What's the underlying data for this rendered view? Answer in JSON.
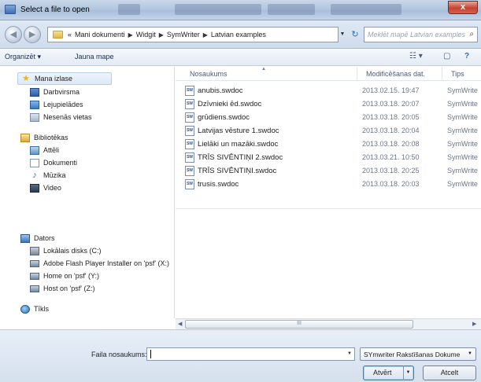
{
  "window": {
    "title": "Select a file to open",
    "close_label": "x"
  },
  "address": {
    "overflow": "«",
    "crumbs": [
      "Mani dokumenti",
      "Widgit",
      "SymWriter",
      "Latvian examples"
    ],
    "search_placeholder": "Meklēt mapē Latvian examples"
  },
  "toolbar": {
    "organize_label": "Organizēt ▾",
    "new_folder_label": "Jauna mape"
  },
  "nav": {
    "favorites": {
      "label": "Mana izlase",
      "items": [
        "Darbvirsma",
        "Lejupielādes",
        "Nesenās vietas"
      ]
    },
    "libraries": {
      "label": "Bibliotēkas",
      "items": [
        "Attēli",
        "Dokumenti",
        "Mūzika",
        "Video"
      ]
    },
    "computer": {
      "label": "Dators",
      "items": [
        "Lokālais disks (C:)",
        "Adobe Flash Player Installer on 'psf' (X:)",
        "Home on 'psf' (Y:)",
        "Host on 'psf' (Z:)"
      ]
    },
    "network": {
      "label": "Tīkls"
    }
  },
  "columns": {
    "name": "Nosaukums",
    "date": "Modificēšanas dat.",
    "type": "Tips"
  },
  "files": [
    {
      "icon": "SW",
      "name": "anubis.swdoc",
      "date": "2013.02.15. 19:47",
      "type": "SymWrite"
    },
    {
      "icon": "SW",
      "name": "Dzīvnieki ēd.swdoc",
      "date": "2013.03.18. 20:07",
      "type": "SymWrite"
    },
    {
      "icon": "SW",
      "name": "grūdiens.swdoc",
      "date": "2013.03.18. 20:05",
      "type": "SymWrite"
    },
    {
      "icon": "SW",
      "name": "Latvijas vēsture 1.swdoc",
      "date": "2013.03.18. 20:04",
      "type": "SymWrite"
    },
    {
      "icon": "SW",
      "name": "Lielāki un mazāki.swdoc",
      "date": "2013.03.18. 20:08",
      "type": "SymWrite"
    },
    {
      "icon": "SW",
      "name": "TRĪS SIVĒNTIŅI 2.swdoc",
      "date": "2013.03.21. 10:50",
      "type": "SymWrite"
    },
    {
      "icon": "SW",
      "name": "TRĪS SIVĒNTIŅI.swdoc",
      "date": "2013.03.18. 20:25",
      "type": "SymWrite"
    },
    {
      "icon": "SW",
      "name": "trusis.swdoc",
      "date": "2013.03.18. 20:03",
      "type": "SymWrite"
    }
  ],
  "scrollbar": {
    "thumb_grip": "III"
  },
  "footer": {
    "filename_label": "Faila nosaukums:",
    "filename_value": "",
    "filetype_value": "SYmwriter Rakstīšanas Dokume",
    "open_label": "Atvērt",
    "cancel_label": "Atcelt"
  }
}
